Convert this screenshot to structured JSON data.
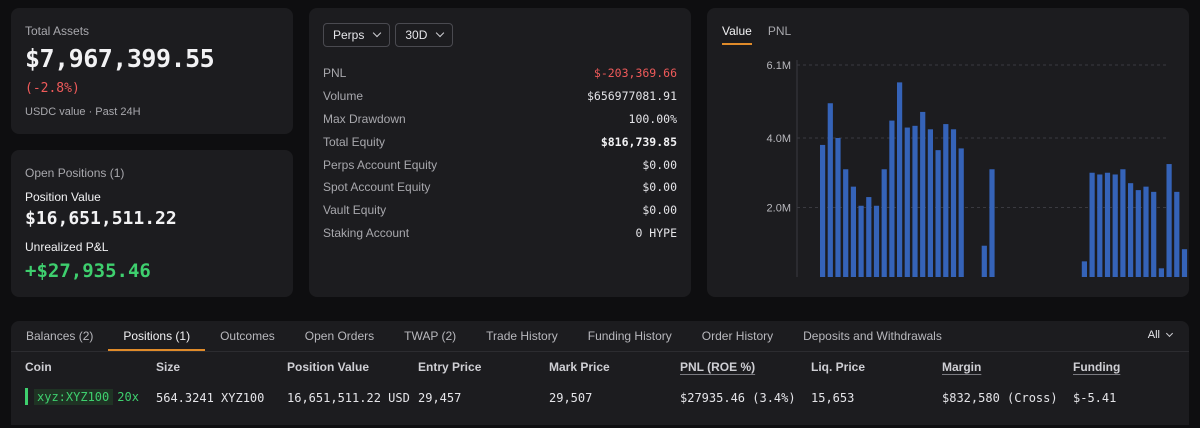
{
  "total_assets": {
    "label": "Total Assets",
    "value": "$7,967,399.55",
    "change": "(-2.8%)",
    "subtitle": "USDC value · Past 24H"
  },
  "open_positions": {
    "title": "Open Positions (1)",
    "position_value_label": "Position Value",
    "position_value": "$16,651,511.22",
    "unrealized_label": "Unrealized P&L",
    "unrealized_value": "+$27,935.46"
  },
  "summary": {
    "market_select": "Perps",
    "period_select": "30D",
    "rows": [
      {
        "label": "PNL",
        "value": "$-203,369.66"
      },
      {
        "label": "Volume",
        "value": "$656977081.91"
      },
      {
        "label": "Max Drawdown",
        "value": "100.00%"
      },
      {
        "label": "Total Equity",
        "value": "$816,739.85"
      },
      {
        "label": "Perps Account Equity",
        "value": "$0.00"
      },
      {
        "label": "Spot Account Equity",
        "value": "$0.00"
      },
      {
        "label": "Vault Equity",
        "value": "$0.00"
      },
      {
        "label": "Staking Account",
        "value": "0 HYPE"
      }
    ]
  },
  "chart_tabs": [
    "Value",
    "PNL"
  ],
  "chart_data": {
    "type": "bar",
    "ytick_labels": [
      "6.1M",
      "4.0M",
      "2.0M"
    ],
    "yticks": [
      6.1,
      4.0,
      2.0
    ],
    "ylim": [
      0,
      6.1
    ],
    "unit": "M",
    "color": "#3563b8",
    "grid": true,
    "values": [
      3.8,
      5.0,
      4.0,
      3.1,
      2.6,
      2.05,
      2.3,
      2.05,
      3.1,
      4.5,
      5.6,
      4.3,
      4.35,
      4.75,
      4.25,
      3.65,
      4.4,
      4.25,
      3.7,
      0,
      0,
      0.9,
      3.1,
      0,
      0,
      0,
      0,
      0,
      0,
      0,
      0,
      0,
      0,
      0,
      0.45,
      3.0,
      2.95,
      3.0,
      2.95,
      3.1,
      2.7,
      2.5,
      2.6,
      2.45,
      0.25,
      3.25,
      2.45,
      0.8
    ]
  },
  "bottom": {
    "tabs": [
      "Balances (2)",
      "Positions (1)",
      "Outcomes",
      "Open Orders",
      "TWAP (2)",
      "Trade History",
      "Funding History",
      "Order History",
      "Deposits and Withdrawals"
    ],
    "filter": "All",
    "headers": [
      "Coin",
      "Size",
      "Position Value",
      "Entry Price",
      "Mark Price",
      "PNL (ROE %)",
      "Liq. Price",
      "Margin",
      "Funding"
    ],
    "row": {
      "coin": "xyz:XYZ100",
      "leverage": "20x",
      "size": "564.3241 XYZ100",
      "position_value": "16,651,511.22 USD",
      "entry_price": "29,457",
      "mark_price": "29,507",
      "pnl": "$27935.46 (3.4%)",
      "liq_price": "15,653",
      "margin": "$832,580 (Cross)",
      "funding": "$-5.41"
    }
  },
  "colors": {
    "background": "#0e0e10",
    "card": "#1c1c1f",
    "accent": "#e08b2a",
    "positive": "#3ecf6e",
    "negative": "#ef5a5a"
  }
}
